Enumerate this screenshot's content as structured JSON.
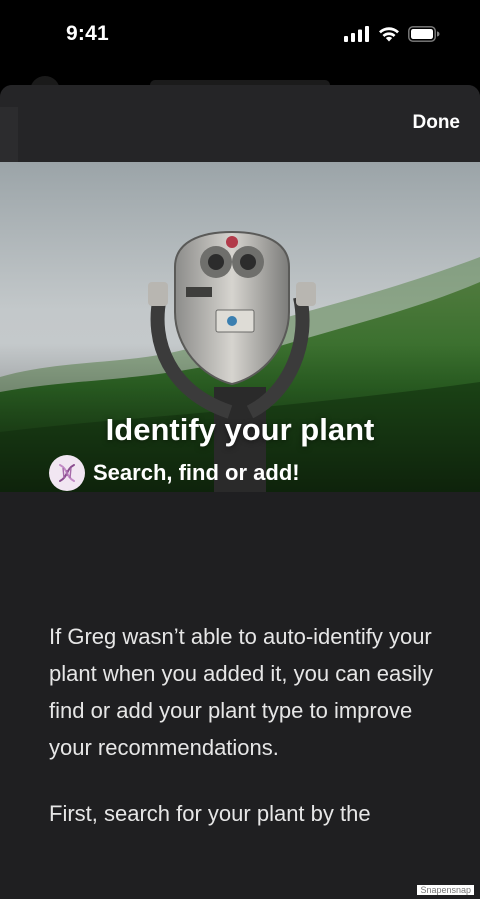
{
  "status": {
    "time": "9:41"
  },
  "nav": {
    "done_label": "Done"
  },
  "hero": {
    "title": "Identify your plant"
  },
  "section": {
    "title": "Search, find or add!",
    "icon": "dna-icon",
    "icon_bg": "#f1e6f2"
  },
  "body": {
    "paragraph1": "If Greg wasn’t able to auto-identify your plant when you added it, you can easily find or add your plant type to improve your recommendations.",
    "paragraph2": "First, search for your plant by the"
  },
  "watermark": "Snapensnap",
  "colors": {
    "sheet_bg": "#1f1f21",
    "nav_bg": "#252527",
    "text": "#ffffff"
  }
}
